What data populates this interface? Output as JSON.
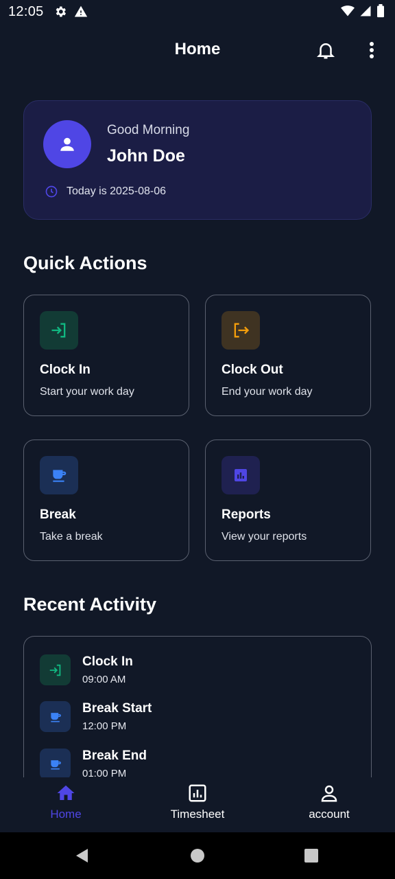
{
  "status_bar": {
    "time": "12:05"
  },
  "app_bar": {
    "title": "Home"
  },
  "greeting": {
    "salutation": "Good Morning",
    "name": "John Doe",
    "date_text": "Today is 2025-08-06"
  },
  "quick_actions": {
    "title": "Quick Actions",
    "items": [
      {
        "title": "Clock In",
        "subtitle": "Start your work day",
        "icon": "login-icon",
        "color": "#10b981",
        "bg": "#123b35"
      },
      {
        "title": "Clock Out",
        "subtitle": "End your work day",
        "icon": "logout-icon",
        "color": "#f59e0b",
        "bg": "#3f3322"
      },
      {
        "title": "Break",
        "subtitle": "Take a break",
        "icon": "coffee-icon",
        "color": "#3b82f6",
        "bg": "#1b2f55"
      },
      {
        "title": "Reports",
        "subtitle": "View your reports",
        "icon": "bar-chart-icon",
        "color": "#4f46e5",
        "bg": "#1f2150"
      }
    ]
  },
  "recent_activity": {
    "title": "Recent Activity",
    "items": [
      {
        "label": "Clock In",
        "time": "09:00 AM",
        "icon": "login-icon"
      },
      {
        "label": "Break Start",
        "time": "12:00 PM",
        "icon": "coffee-icon"
      },
      {
        "label": "Break End",
        "time": "01:00 PM",
        "icon": "coffee-icon"
      }
    ]
  },
  "bottom_nav": {
    "items": [
      {
        "label": "Home",
        "icon": "home-icon",
        "active": true
      },
      {
        "label": "Timesheet",
        "icon": "timesheet-icon",
        "active": false
      },
      {
        "label": "account",
        "icon": "person-icon",
        "active": false
      }
    ],
    "active_color": "#4f46e5"
  },
  "colors": {
    "background": "#111827",
    "card": "#1b1d45",
    "accent": "#4f46e5"
  }
}
